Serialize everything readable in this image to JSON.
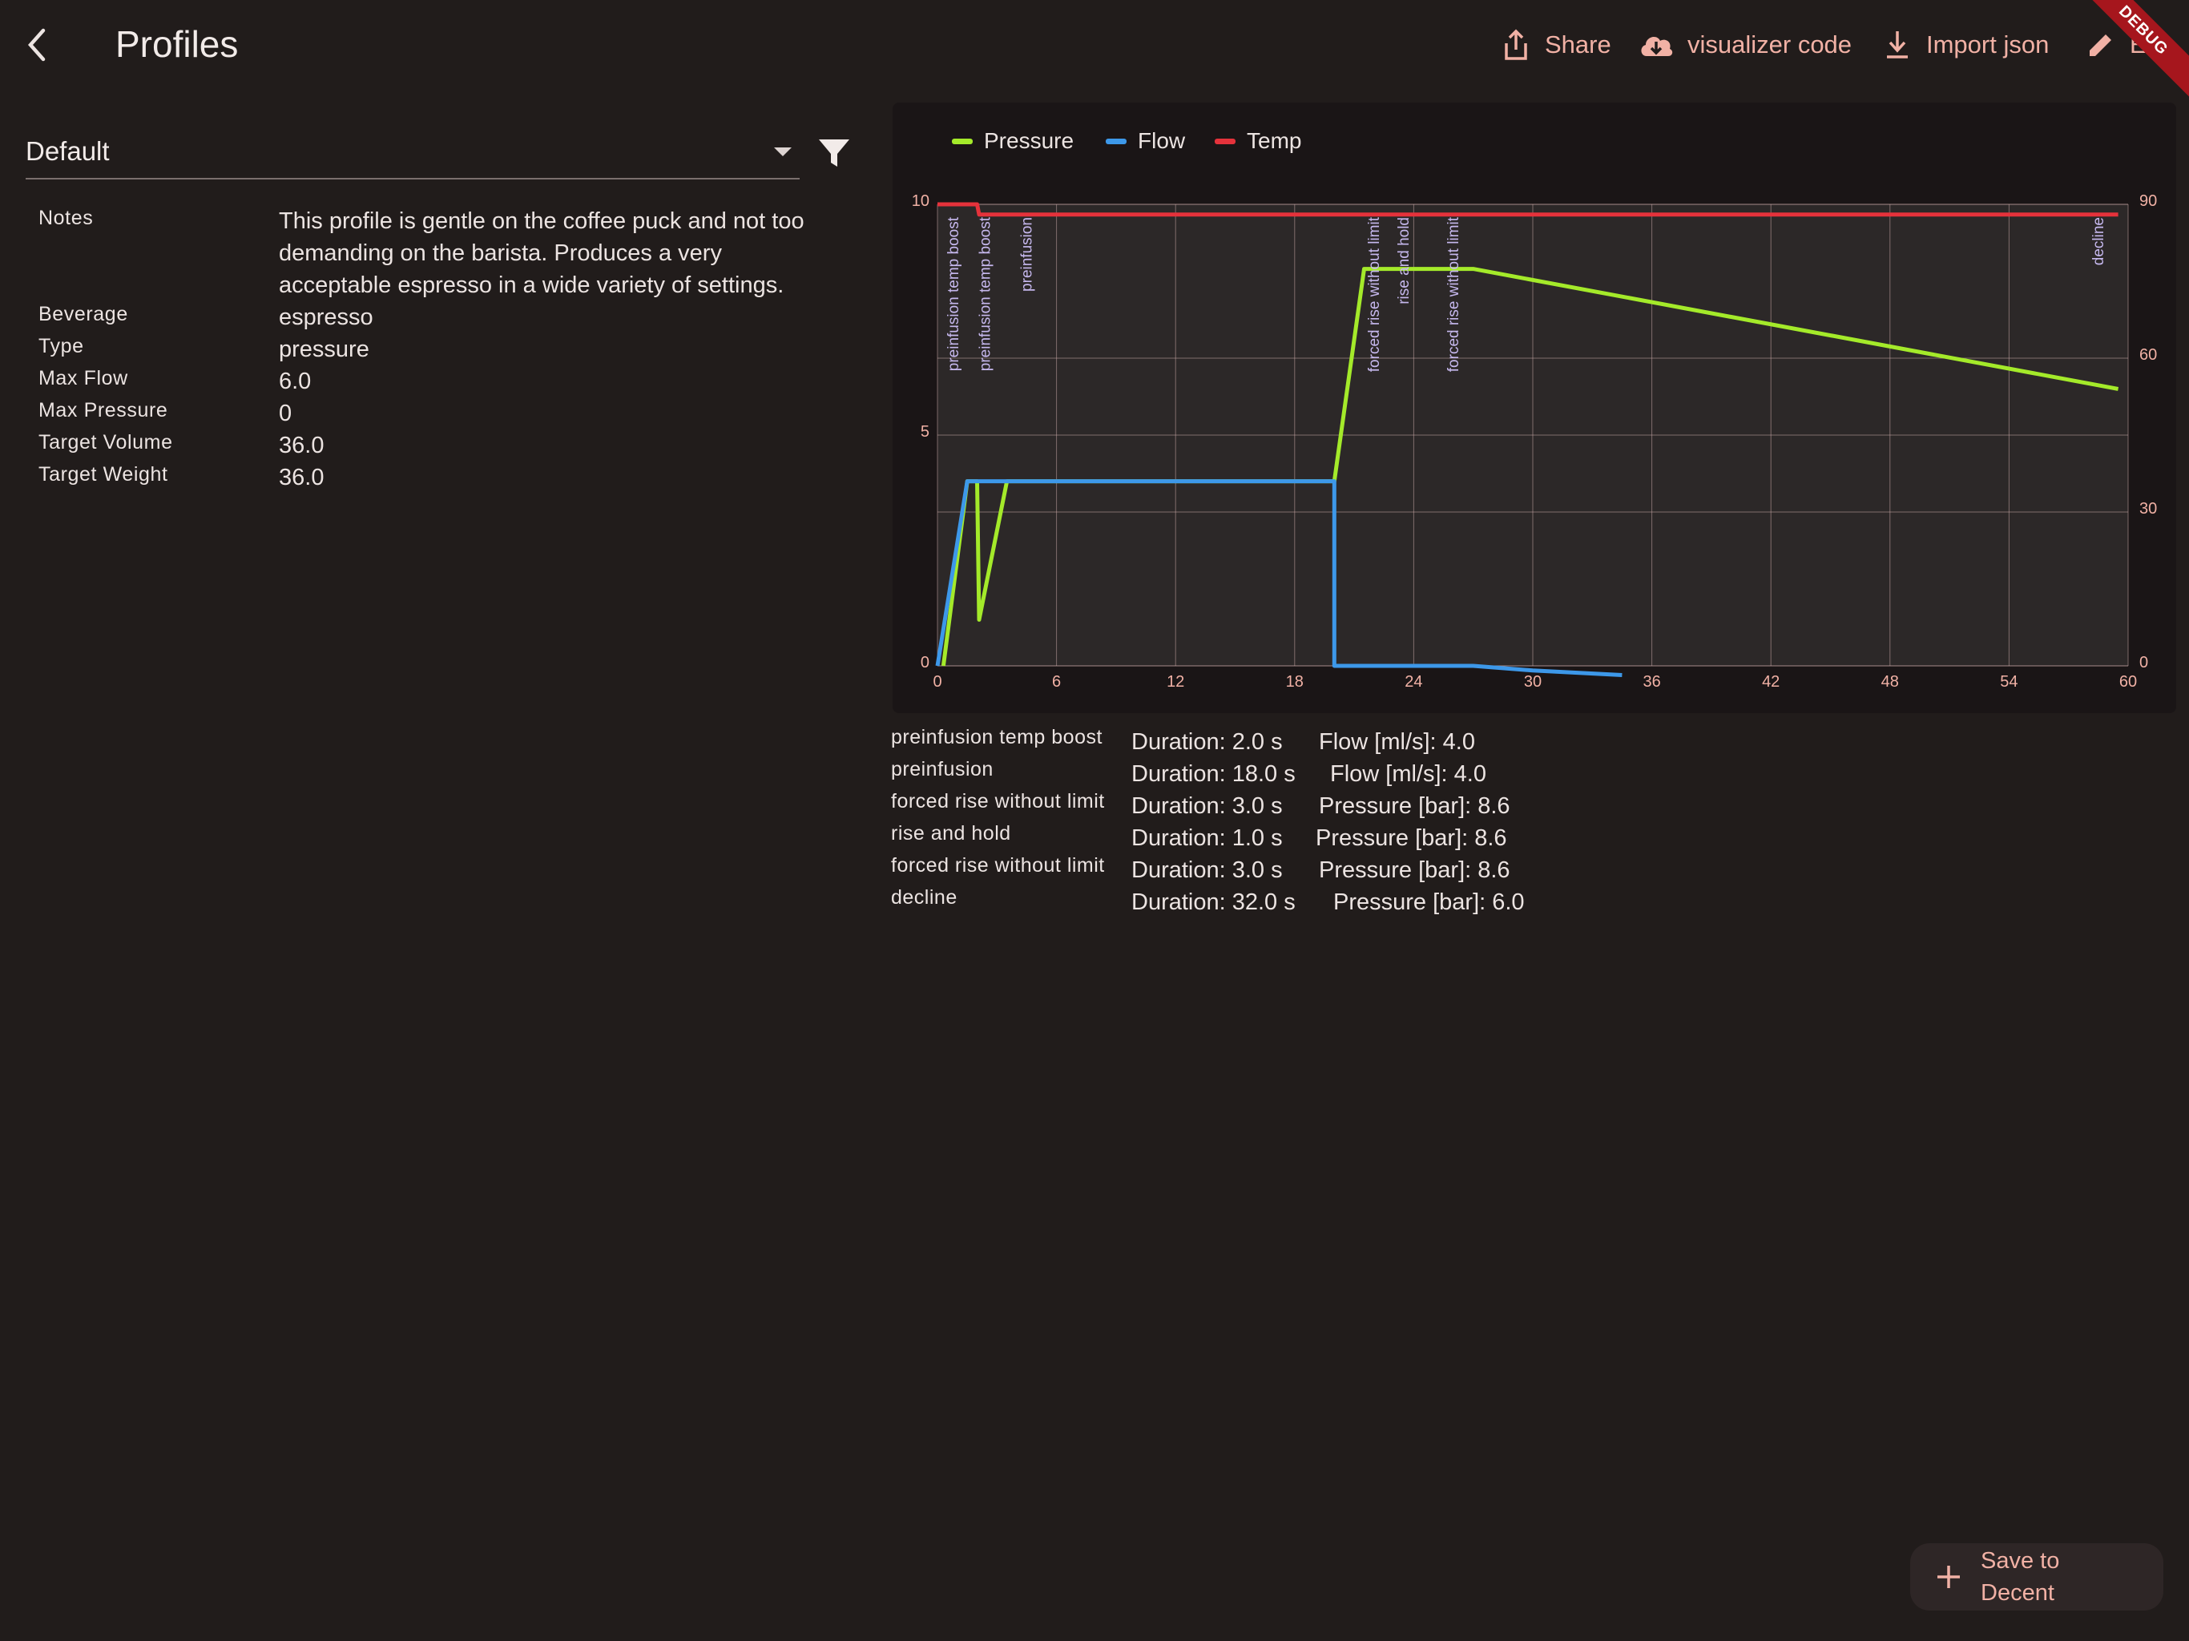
{
  "app_bar": {
    "title": "Profiles",
    "actions": [
      {
        "label": "Share",
        "icon": "share-icon"
      },
      {
        "label": "visualizer code",
        "icon": "cloud-download-icon"
      },
      {
        "label": "Import json",
        "icon": "download-icon"
      },
      {
        "label": "E",
        "icon": "edit-icon"
      }
    ],
    "debug_banner": "DEBUG"
  },
  "profile_select": {
    "value": "Default"
  },
  "details": {
    "notes_label": "Notes",
    "notes": [
      "This profile is gentle on the coffee puck and not too",
      "demanding on the barista.  Produces a very",
      "acceptable espresso in a wide variety of settings."
    ],
    "rows": [
      {
        "label": "Beverage",
        "value": "espresso"
      },
      {
        "label": "Type",
        "value": "pressure"
      },
      {
        "label": "Max Flow",
        "value": "6.0"
      },
      {
        "label": "Max Pressure",
        "value": "0"
      },
      {
        "label": "Target Volume",
        "value": "36.0"
      },
      {
        "label": "Target Weight",
        "value": "36.0"
      }
    ]
  },
  "chart_data": {
    "type": "line",
    "legend": [
      {
        "name": "Pressure",
        "color": "#a4ea2a"
      },
      {
        "name": "Flow",
        "color": "#3d98e9"
      },
      {
        "name": "Temp",
        "color": "#e5323b"
      }
    ],
    "legend_position": "top-left",
    "xlim": [
      0,
      60
    ],
    "x_ticks": [
      "0",
      "6",
      "12",
      "18",
      "24",
      "30",
      "36",
      "42",
      "48",
      "54",
      "60"
    ],
    "ylim_left": [
      0,
      10
    ],
    "y_left_ticks": [
      "0",
      "5",
      "10"
    ],
    "ylim_right": [
      0,
      90
    ],
    "y_right_ticks": [
      "0",
      "30",
      "60",
      "90"
    ],
    "grid": true,
    "series": [
      {
        "name": "Pressure",
        "axis": "left",
        "color": "#a4ea2a",
        "points": [
          [
            0.3,
            0
          ],
          [
            1.5,
            4.0
          ],
          [
            2.0,
            4.0
          ],
          [
            2.1,
            1.0
          ],
          [
            3.5,
            4.0
          ],
          [
            20.0,
            4.0
          ],
          [
            21.5,
            8.6
          ],
          [
            27.0,
            8.6
          ],
          [
            59.5,
            6.0
          ]
        ]
      },
      {
        "name": "Flow",
        "axis": "left",
        "color": "#3d98e9",
        "points": [
          [
            0,
            0
          ],
          [
            1.5,
            4.0
          ],
          [
            20.0,
            4.0
          ],
          [
            20.0,
            0
          ],
          [
            27.0,
            0
          ],
          [
            30.0,
            -0.1
          ],
          [
            34.5,
            -0.2
          ]
        ]
      },
      {
        "name": "Temp",
        "axis": "right",
        "color": "#e5323b",
        "points": [
          [
            0,
            90
          ],
          [
            2.0,
            90
          ],
          [
            2.1,
            88
          ],
          [
            59.5,
            88
          ]
        ]
      }
    ],
    "annotations": [
      {
        "text": "preinfusion temp boost",
        "x": 0.8
      },
      {
        "text": "preinfusion temp boost",
        "x": 2.4
      },
      {
        "text": "preinfusion",
        "x": 4.5
      },
      {
        "text": "forced rise without limit",
        "x": 22.0
      },
      {
        "text": "rise and hold",
        "x": 23.5
      },
      {
        "text": "forced rise without limit",
        "x": 26.0
      },
      {
        "text": "decline",
        "x": 58.5
      }
    ]
  },
  "steps": [
    {
      "name": "preinfusion temp boost",
      "duration": "Duration: 2.0 s",
      "value": "Flow [ml/s]: 4.0"
    },
    {
      "name": "preinfusion",
      "duration": "Duration: 18.0 s",
      "value": "Flow [ml/s]: 4.0"
    },
    {
      "name": "forced rise without limit",
      "duration": "Duration: 3.0 s",
      "value": "Pressure [bar]: 8.6"
    },
    {
      "name": "rise and hold",
      "duration": "Duration: 1.0 s",
      "value": "Pressure [bar]: 8.6"
    },
    {
      "name": "forced rise without limit",
      "duration": "Duration: 3.0 s",
      "value": "Pressure [bar]: 8.6"
    },
    {
      "name": "decline",
      "duration": "Duration: 32.0 s",
      "value": "Pressure [bar]: 6.0"
    }
  ],
  "fab": {
    "label_line1": "Save to",
    "label_line2": "Decent"
  }
}
